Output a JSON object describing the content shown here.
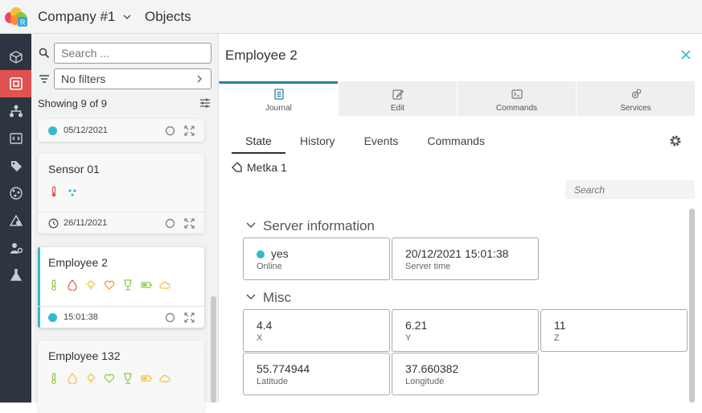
{
  "header": {
    "company": "Company #1",
    "section": "Objects"
  },
  "list": {
    "search_placeholder": "Search ...",
    "filter_label": "No filters",
    "showing": "Showing 9 of 9",
    "cards": [
      {
        "title": "",
        "time": "05/12/2021",
        "status": "online"
      },
      {
        "title": "Sensor 01",
        "time": "26/11/2021",
        "status": "offline"
      },
      {
        "title": "Employee 2",
        "time": "15:01:38",
        "status": "online",
        "selected": true
      },
      {
        "title": "Employee 132"
      }
    ]
  },
  "detail": {
    "title": "Employee 2",
    "tabs": [
      {
        "label": "Journal",
        "icon": "journal-icon",
        "active": true
      },
      {
        "label": "Edit",
        "icon": "edit-icon"
      },
      {
        "label": "Commands",
        "icon": "terminal-icon"
      },
      {
        "label": "Services",
        "icon": "services-icon"
      }
    ],
    "subtabs": [
      "State",
      "History",
      "Events",
      "Commands"
    ],
    "tag": "Metka 1",
    "search_placeholder": "Search",
    "groups": [
      {
        "title": "Server information",
        "fields": [
          {
            "value": "yes",
            "label": "Online"
          },
          {
            "value": "20/12/2021 15:01:38",
            "label": "Server time"
          }
        ]
      },
      {
        "title": "Misc",
        "fields": [
          {
            "value": "4.4",
            "label": "X"
          },
          {
            "value": "6.21",
            "label": "Y"
          },
          {
            "value": "11",
            "label": "Z"
          },
          {
            "value": "55.774944",
            "label": "Latitude"
          },
          {
            "value": "37.660382",
            "label": "Longitude"
          }
        ]
      }
    ]
  },
  "colors": {
    "accent": "#35b9cf",
    "sidebar": "#2d3540",
    "sidebar_active": "#e0524f",
    "tab_active": "#2b7fa6"
  }
}
